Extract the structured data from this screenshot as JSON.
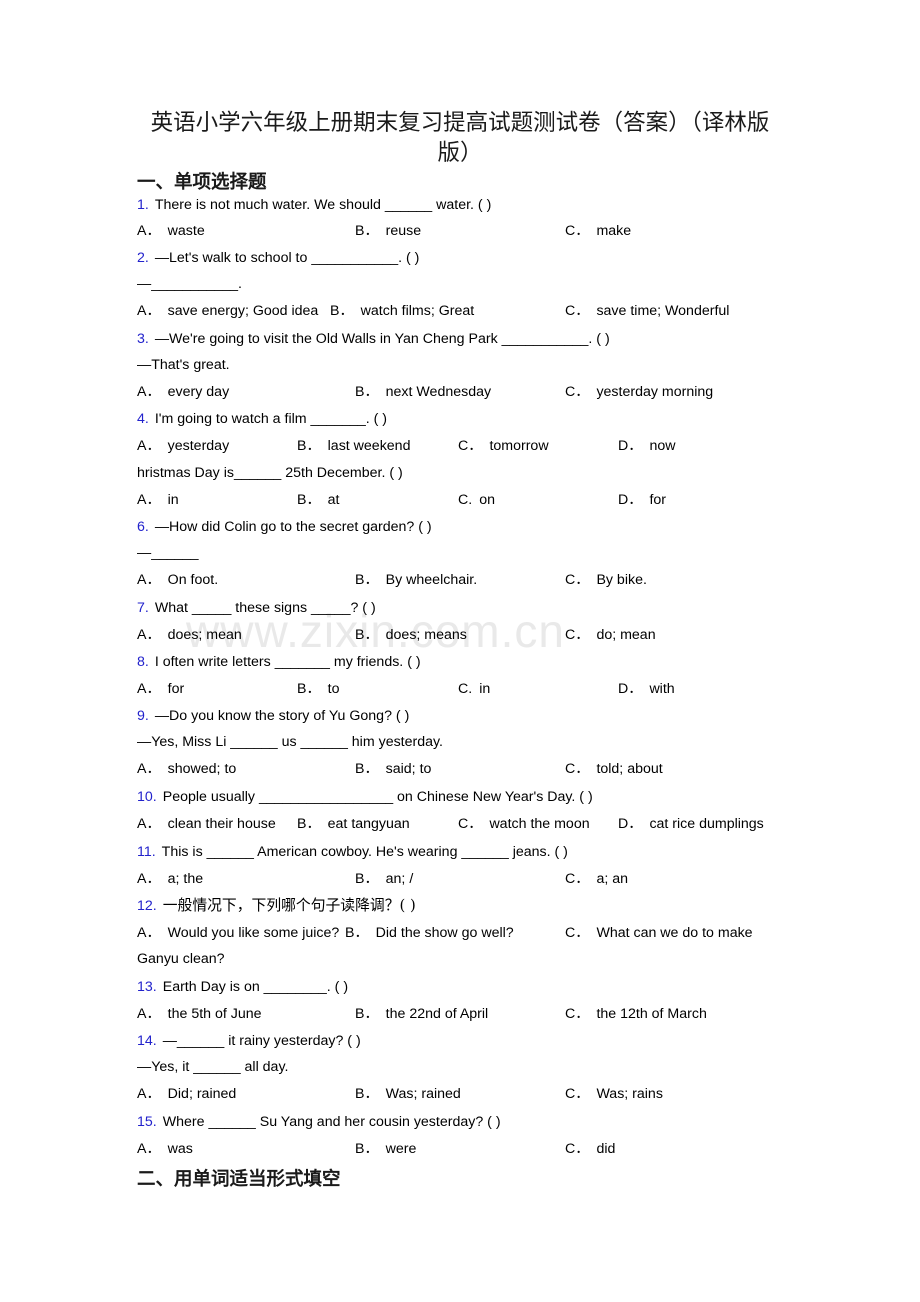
{
  "document": {
    "title": "英语小学六年级上册期末复习提高试题测试卷（答案）（译林版版）",
    "watermark": "www.zixin.com.cn"
  },
  "sections": [
    {
      "id": "sec1",
      "heading": "一、单项选择题"
    },
    {
      "id": "sec2",
      "heading": "二、用单词适当形式填空"
    }
  ],
  "questions": [
    {
      "num": "1.",
      "stem": "There is not much water. We should ______ water. (    )",
      "cont": null,
      "options": [
        {
          "letter": "A．",
          "text": "waste"
        },
        {
          "letter": "B．",
          "text": "reuse"
        },
        {
          "letter": "C．",
          "text": "make"
        }
      ]
    },
    {
      "num": "2.",
      "stem": "—Let's walk to school to ___________. (    )",
      "cont": "—___________.",
      "options": [
        {
          "letter": "A．",
          "text": "save energy; Good idea"
        },
        {
          "letter": "B．",
          "text": "watch films; Great"
        },
        {
          "letter": "C．",
          "text": "save time; Wonderful"
        }
      ]
    },
    {
      "num": "3.",
      "stem": "—We're going to visit the Old Walls in Yan Cheng Park ___________. (    )",
      "cont": "—That's great.",
      "options": [
        {
          "letter": "A．",
          "text": "every day"
        },
        {
          "letter": "B．",
          "text": "next Wednesday"
        },
        {
          "letter": "C．",
          "text": "yesterday morning"
        }
      ]
    },
    {
      "num": "4.",
      "stem": "I'm going to watch a film _______. (    )",
      "cont": null,
      "options": [
        {
          "letter": "A．",
          "text": "yesterday"
        },
        {
          "letter": "B．",
          "text": "last weekend"
        },
        {
          "letter": "C．",
          "text": "tomorrow"
        },
        {
          "letter": "D．",
          "text": "now"
        }
      ]
    },
    {
      "num": "",
      "stem": "hristmas Day is______ 25th December. (    )",
      "cont": null,
      "options": [
        {
          "letter": "A．",
          "text": "in"
        },
        {
          "letter": "B．",
          "text": "at"
        },
        {
          "letter": "C.",
          "text": "on"
        },
        {
          "letter": "D．",
          "text": "for"
        }
      ]
    },
    {
      "num": "6.",
      "stem": "—How did Colin go to the secret garden? (    )",
      "cont": "—______",
      "options": [
        {
          "letter": "A．",
          "text": "On foot."
        },
        {
          "letter": "B．",
          "text": "By wheelchair."
        },
        {
          "letter": "C．",
          "text": "By bike."
        }
      ]
    },
    {
      "num": "7.",
      "stem": "What _____ these signs _____? (    )",
      "cont": null,
      "options": [
        {
          "letter": "A．",
          "text": "does; mean"
        },
        {
          "letter": "B．",
          "text": "does; means"
        },
        {
          "letter": "C．",
          "text": "do; mean"
        }
      ]
    },
    {
      "num": "8.",
      "stem": "I often write letters _______ my friends. (    )",
      "cont": null,
      "options": [
        {
          "letter": "A．",
          "text": "for"
        },
        {
          "letter": "B．",
          "text": "to"
        },
        {
          "letter": "C.",
          "text": "in"
        },
        {
          "letter": "D．",
          "text": "with"
        }
      ]
    },
    {
      "num": "9.",
      "stem": "—Do you know the story of Yu Gong? (    )",
      "cont": "—Yes, Miss Li ______ us ______ him yesterday.",
      "options": [
        {
          "letter": "A．",
          "text": "showed; to"
        },
        {
          "letter": "B．",
          "text": "said; to"
        },
        {
          "letter": "C．",
          "text": "told; about"
        }
      ]
    },
    {
      "num": "10.",
      "stem": "People usually _________________ on Chinese New Year's Day. (    )",
      "cont": null,
      "options": [
        {
          "letter": "A．",
          "text": "clean their house"
        },
        {
          "letter": "B．",
          "text": "eat tangyuan"
        },
        {
          "letter": "C．",
          "text": "watch the moon"
        },
        {
          "letter": "D．",
          "text": "cat rice dumplings"
        }
      ]
    },
    {
      "num": "11.",
      "stem": "This is ______ American cowboy. He's wearing ______ jeans. (    )",
      "cont": null,
      "options": [
        {
          "letter": "A．",
          "text": "a; the"
        },
        {
          "letter": "B．",
          "text": "an; /"
        },
        {
          "letter": "C．",
          "text": "a; an"
        }
      ]
    },
    {
      "num": "12.",
      "stem": "一般情况下，下列哪个句子读降调？(  )",
      "cont": null,
      "options": [
        {
          "letter": "A．",
          "text": "Would you like some juice?"
        },
        {
          "letter": "B．",
          "text": "Did the show go well?"
        },
        {
          "letter": "C．",
          "text": "What can we do to make"
        }
      ],
      "options_overflow": "Ganyu clean?"
    },
    {
      "num": "13.",
      "stem": "Earth Day is on ________. (    )",
      "cont": null,
      "options": [
        {
          "letter": "A．",
          "text": "the 5th of June"
        },
        {
          "letter": "B．",
          "text": "the 22nd of April"
        },
        {
          "letter": "C．",
          "text": "the 12th of March"
        }
      ]
    },
    {
      "num": "14.",
      "stem": "—______ it rainy yesterday? (    )",
      "cont": "—Yes, it ______ all day.",
      "options": [
        {
          "letter": "A．",
          "text": "Did; rained"
        },
        {
          "letter": "B．",
          "text": "Was; rained"
        },
        {
          "letter": "C．",
          "text": "Was; rains"
        }
      ]
    },
    {
      "num": "15.",
      "stem": "Where ______ Su Yang and her cousin yesterday? (    )",
      "cont": null,
      "options": [
        {
          "letter": "A．",
          "text": "was"
        },
        {
          "letter": "B．",
          "text": "were"
        },
        {
          "letter": "C．",
          "text": "did"
        }
      ]
    }
  ]
}
